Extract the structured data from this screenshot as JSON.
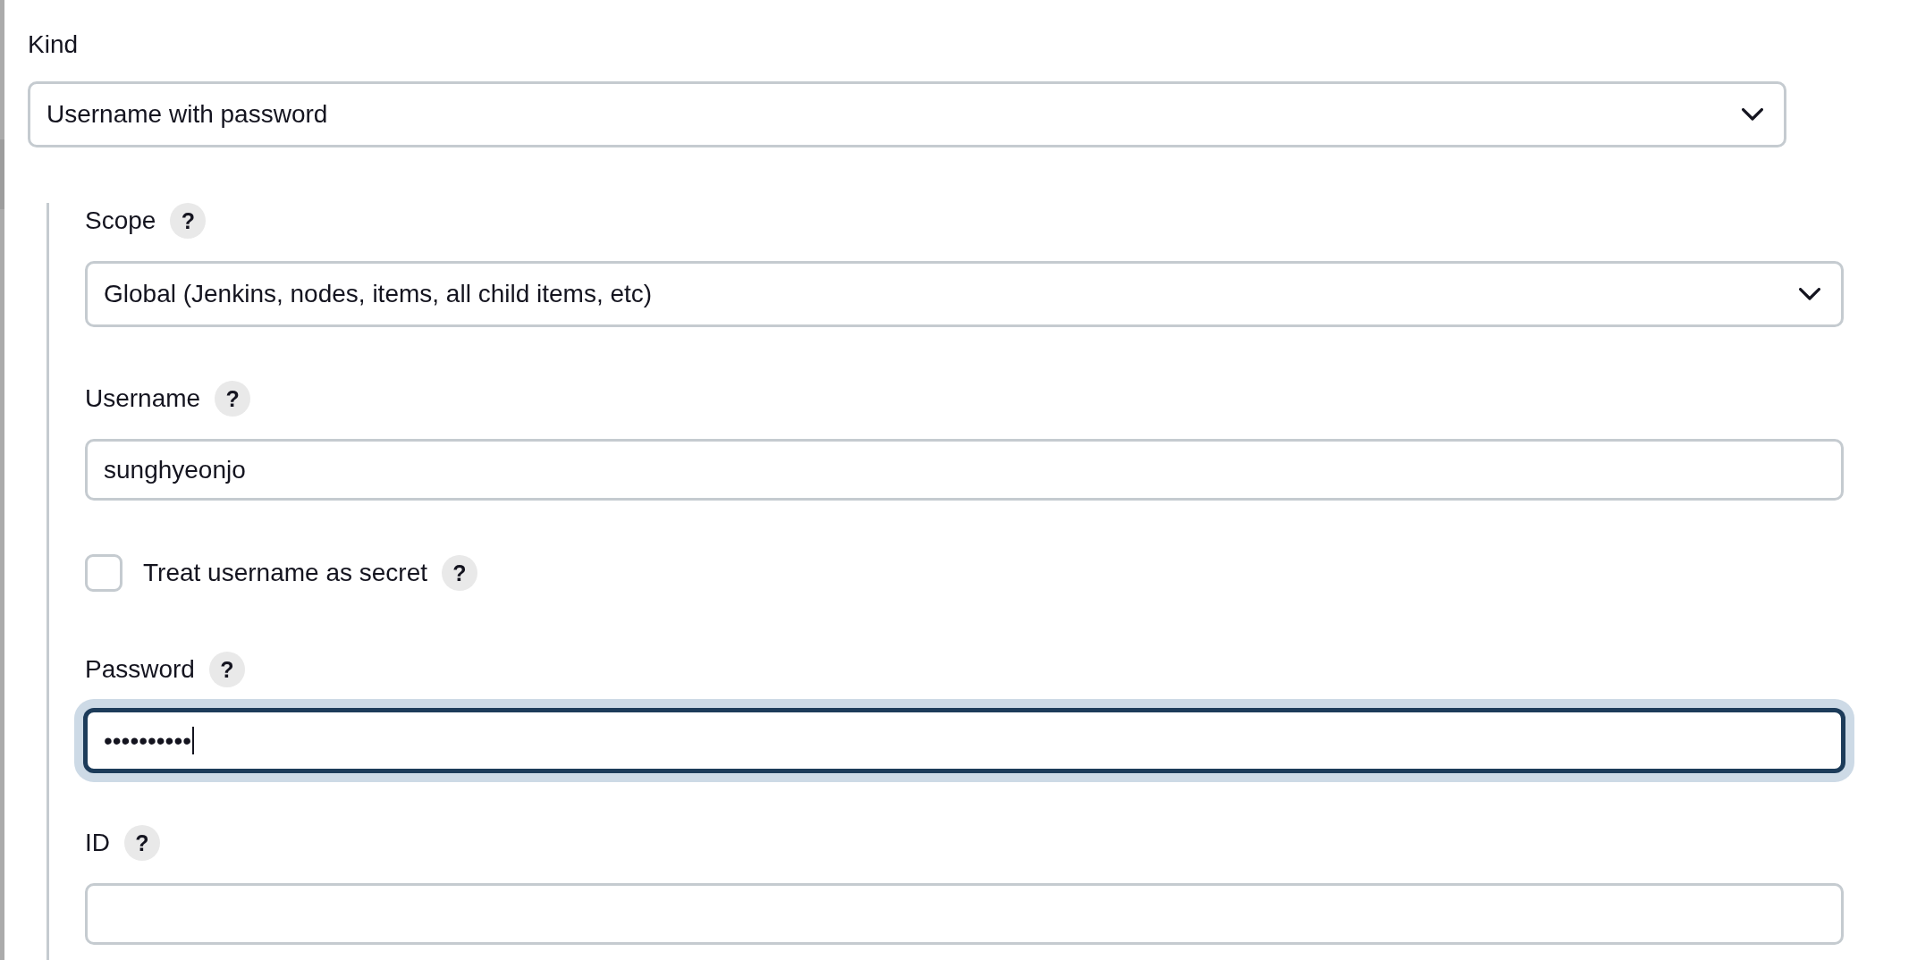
{
  "kind": {
    "label": "Kind",
    "value": "Username with password",
    "focused": false
  },
  "fields": [
    {
      "kind": "select",
      "label": "Scope",
      "help": "?",
      "value": "Global (Jenkins, nodes, items, all child items, etc)",
      "focused": false
    },
    {
      "kind": "text",
      "label": "Username",
      "help": "?",
      "value": "sunghyeonjo",
      "focused": false
    },
    {
      "kind": "checkbox",
      "label": "Treat username as secret",
      "help": "?",
      "checked": false,
      "focused": false
    },
    {
      "kind": "password",
      "label": "Password",
      "help": "?",
      "value": "••••••••••",
      "focused": true
    },
    {
      "kind": "text",
      "label": "ID",
      "help": "?",
      "focused": false
    }
  ]
}
